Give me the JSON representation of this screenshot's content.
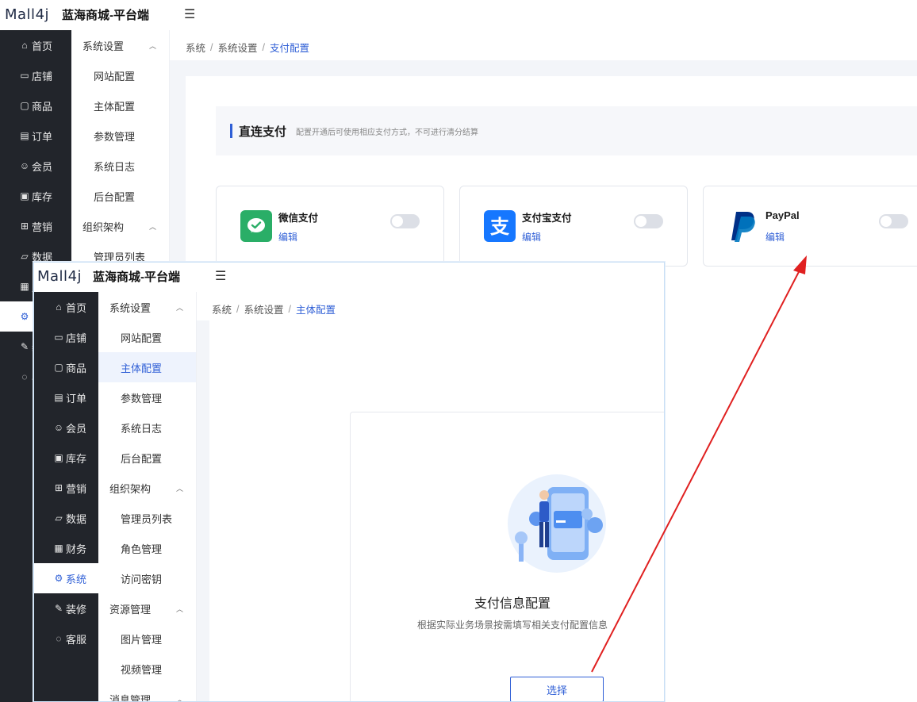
{
  "brand": {
    "logo_text": "Mall4j",
    "app_title": "蓝海商城-平台端"
  },
  "main_nav": [
    {
      "label": "首页",
      "icon": "home-icon"
    },
    {
      "label": "店铺",
      "icon": "shop-icon"
    },
    {
      "label": "商品",
      "icon": "goods-icon"
    },
    {
      "label": "订单",
      "icon": "order-icon"
    },
    {
      "label": "会员",
      "icon": "member-icon"
    },
    {
      "label": "库存",
      "icon": "inventory-icon"
    },
    {
      "label": "营销",
      "icon": "gift-icon"
    },
    {
      "label": "数据",
      "icon": "data-icon"
    },
    {
      "label": "财务",
      "icon": "finance-icon"
    },
    {
      "label": "系统",
      "icon": "settings-icon"
    },
    {
      "label": "装修",
      "icon": "decoration-icon"
    },
    {
      "label": "客服",
      "icon": "chat-icon"
    }
  ],
  "sub_nav": [
    {
      "label": "系统设置",
      "type": "group"
    },
    {
      "label": "网站配置",
      "type": "item"
    },
    {
      "label": "主体配置",
      "type": "item"
    },
    {
      "label": "参数管理",
      "type": "item"
    },
    {
      "label": "系统日志",
      "type": "item"
    },
    {
      "label": "后台配置",
      "type": "item"
    },
    {
      "label": "组织架构",
      "type": "group"
    },
    {
      "label": "管理员列表",
      "type": "item"
    },
    {
      "label": "角色管理",
      "type": "item"
    },
    {
      "label": "访问密钥",
      "type": "item"
    },
    {
      "label": "资源管理",
      "type": "group"
    },
    {
      "label": "图片管理",
      "type": "item"
    },
    {
      "label": "视频管理",
      "type": "item"
    },
    {
      "label": "消息管理",
      "type": "group"
    }
  ],
  "bg_breadcrumb": [
    "系统",
    "系统设置",
    "支付配置"
  ],
  "fg_breadcrumb": [
    "系统",
    "系统设置",
    "主体配置"
  ],
  "direct_pay": {
    "title": "直连支付",
    "desc": "配置开通后可使用相应支付方式，不可进行清分结算"
  },
  "pay_methods": [
    {
      "name": "微信支付",
      "edit": "编辑",
      "icon": "wechat-pay-icon",
      "enabled": false
    },
    {
      "name": "支付宝支付",
      "edit": "编辑",
      "icon": "alipay-icon",
      "enabled": false
    },
    {
      "name": "PayPal",
      "edit": "编辑",
      "icon": "paypal-icon",
      "enabled": false
    }
  ],
  "payment_config": {
    "title": "支付信息配置",
    "desc": "根据实际业务场景按需填写相关支付配置信息",
    "button": "选择"
  },
  "colors": {
    "accent": "#2f5fd6",
    "sidebar_dark": "#22252b",
    "wechat": "#2aae67",
    "alipay": "#1677ff",
    "paypal": "#003087",
    "annotation_arrow": "#e02020"
  }
}
